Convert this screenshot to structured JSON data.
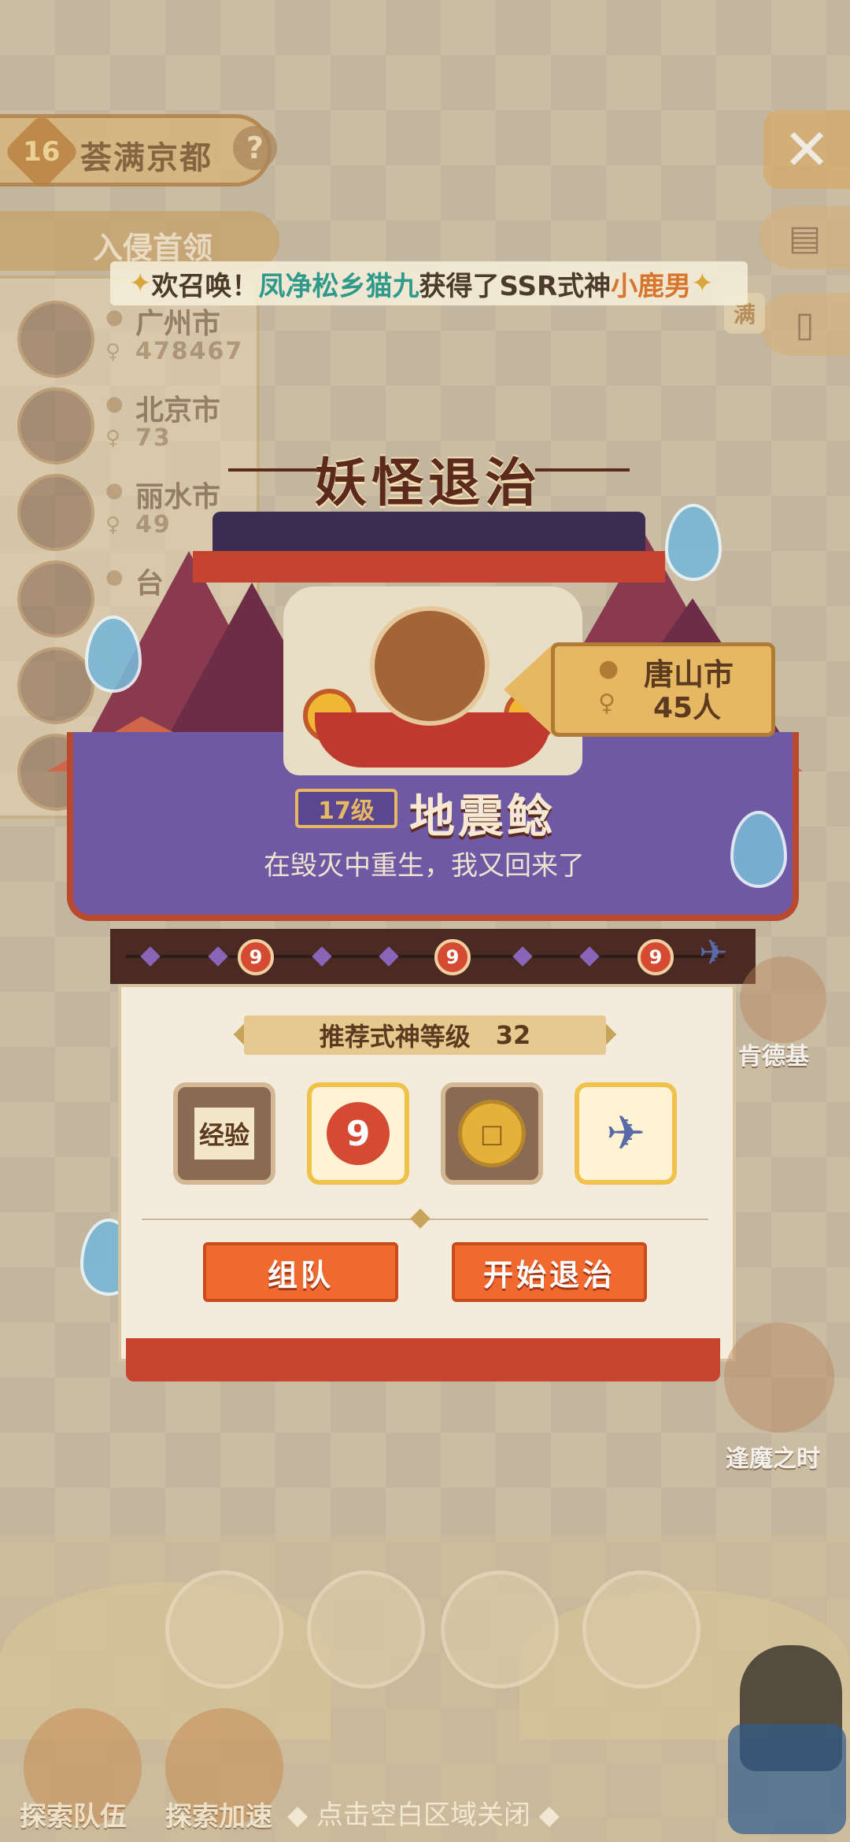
{
  "top": {
    "level": "16",
    "city_title": "荟满京都",
    "help_icon": "question-icon",
    "close_icon": "close-icon"
  },
  "invasion": {
    "label": "入侵首领",
    "bosses": [
      {
        "city": "广州市",
        "count": "478467"
      },
      {
        "city": "北京市",
        "count": "73"
      },
      {
        "city": "丽水市",
        "count": "49"
      },
      {
        "city": "台",
        "count": ""
      }
    ]
  },
  "announcement": {
    "prefix": "欢召唤！",
    "player": "凤净松乡猫九",
    "middle": "获得了SSR式神",
    "shikigami": "小鹿男"
  },
  "card": {
    "title": "妖怪退治",
    "sign_city": "唐山市",
    "sign_count": "45人",
    "level": "17级",
    "boss_name": "地震鲶",
    "quote": "在毁灭中重生，我又回来了",
    "recommend_label": "推荐式神等级",
    "recommend_value": "32",
    "rewards": [
      "经验",
      "",
      "",
      ""
    ],
    "team_button": "组队",
    "start_button": "开始退治"
  },
  "progress_coin_glyph": "9",
  "right_side": {
    "kendeji": "肯德基",
    "fengmo": "逢魔之时",
    "full_badge": "满"
  },
  "bottom": {
    "explore_team": "探索队伍",
    "explore_speed": "探索加速",
    "close_hint": "◆ 点击空白区域关闭 ◆"
  }
}
